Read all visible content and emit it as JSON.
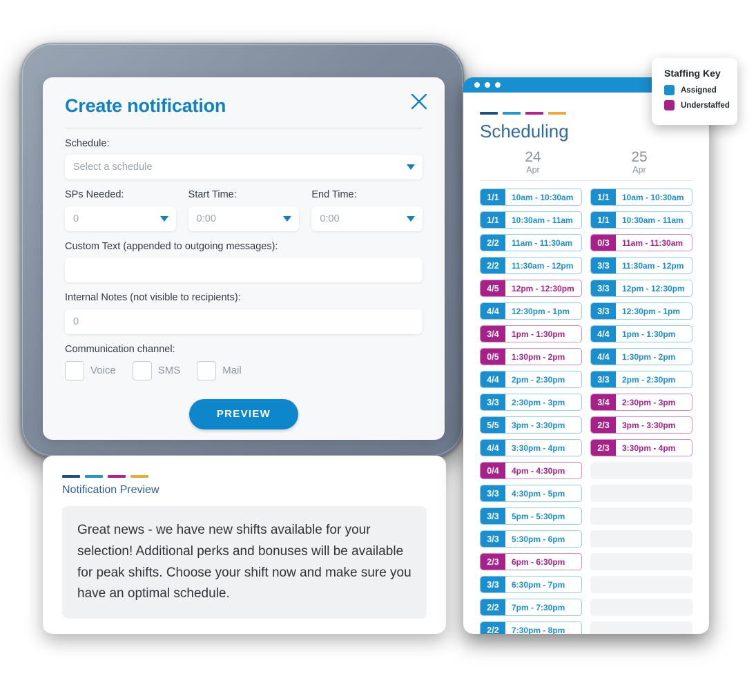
{
  "dialog": {
    "title": "Create notification",
    "close_icon": "close-x-icon",
    "schedule_label": "Schedule:",
    "schedule_placeholder": "Select a schedule",
    "sps_label": "SPs Needed:",
    "sps_value": "0",
    "start_label": "Start Time:",
    "start_value": "0:00",
    "end_label": "End Time:",
    "end_value": "0:00",
    "custom_text_label": "Custom Text (appended to outgoing messages):",
    "custom_text_value": "",
    "internal_notes_label": "Internal Notes (not visible to recipients):",
    "internal_notes_value": "0",
    "channel_label": "Communication channel:",
    "channels": [
      {
        "label": "Voice",
        "checked": false
      },
      {
        "label": "SMS",
        "checked": false
      },
      {
        "label": "Mail",
        "checked": false
      }
    ],
    "preview_button": "PREVIEW"
  },
  "preview": {
    "heading": "Notification Preview",
    "message": "Great news - we have new shifts available for your selection! Additional perks and bonuses will be available for peak shifts. Choose your shift now and make sure you have an optimal schedule.",
    "stripe_colors": [
      "#1d4f82",
      "#2196d6",
      "#b5218f",
      "#efa83b"
    ]
  },
  "scheduling": {
    "window_dots": 3,
    "stripe_colors": [
      "#1d4f82",
      "#2196d6",
      "#b5218f",
      "#efa83b"
    ],
    "title": "Scheduling",
    "days": [
      {
        "num": "24",
        "month": "Apr"
      },
      {
        "num": "25",
        "month": "Apr"
      }
    ],
    "columns": [
      {
        "day": "24 Apr",
        "shifts": [
          {
            "count": "1/1",
            "time": "10am - 10:30am",
            "status": "assigned"
          },
          {
            "count": "1/1",
            "time": "10:30am - 11am",
            "status": "assigned"
          },
          {
            "count": "2/2",
            "time": "11am - 11:30am",
            "status": "assigned"
          },
          {
            "count": "2/2",
            "time": "11:30am - 12pm",
            "status": "assigned"
          },
          {
            "count": "4/5",
            "time": "12pm - 12:30pm",
            "status": "understaffed"
          },
          {
            "count": "4/4",
            "time": "12:30pm - 1pm",
            "status": "assigned"
          },
          {
            "count": "3/4",
            "time": "1pm - 1:30pm",
            "status": "understaffed"
          },
          {
            "count": "0/5",
            "time": "1:30pm - 2pm",
            "status": "understaffed"
          },
          {
            "count": "4/4",
            "time": "2pm - 2:30pm",
            "status": "assigned"
          },
          {
            "count": "3/3",
            "time": "2:30pm - 3pm",
            "status": "assigned"
          },
          {
            "count": "5/5",
            "time": "3pm - 3:30pm",
            "status": "assigned"
          },
          {
            "count": "4/4",
            "time": "3:30pm - 4pm",
            "status": "assigned"
          },
          {
            "count": "0/4",
            "time": "4pm - 4:30pm",
            "status": "understaffed"
          },
          {
            "count": "3/3",
            "time": "4:30pm - 5pm",
            "status": "assigned"
          },
          {
            "count": "3/3",
            "time": "5pm - 5:30pm",
            "status": "assigned"
          },
          {
            "count": "3/3",
            "time": "5:30pm - 6pm",
            "status": "assigned"
          },
          {
            "count": "2/3",
            "time": "6pm - 6:30pm",
            "status": "understaffed"
          },
          {
            "count": "3/3",
            "time": "6:30pm - 7pm",
            "status": "assigned"
          },
          {
            "count": "2/2",
            "time": "7pm - 7:30pm",
            "status": "assigned"
          },
          {
            "count": "2/2",
            "time": "7:30pm - 8pm",
            "status": "assigned"
          }
        ]
      },
      {
        "day": "25 Apr",
        "shifts": [
          {
            "count": "1/1",
            "time": "10am - 10:30am",
            "status": "assigned"
          },
          {
            "count": "1/1",
            "time": "10:30am - 11am",
            "status": "assigned"
          },
          {
            "count": "0/3",
            "time": "11am - 11:30am",
            "status": "understaffed"
          },
          {
            "count": "3/3",
            "time": "11:30am - 12pm",
            "status": "assigned"
          },
          {
            "count": "3/3",
            "time": "12pm - 12:30pm",
            "status": "assigned"
          },
          {
            "count": "3/3",
            "time": "12:30pm - 1pm",
            "status": "assigned"
          },
          {
            "count": "4/4",
            "time": "1pm - 1:30pm",
            "status": "assigned"
          },
          {
            "count": "4/4",
            "time": "1:30pm - 2pm",
            "status": "assigned"
          },
          {
            "count": "3/3",
            "time": "2pm - 2:30pm",
            "status": "assigned"
          },
          {
            "count": "3/4",
            "time": "2:30pm - 3pm",
            "status": "understaffed"
          },
          {
            "count": "2/3",
            "time": "3pm - 3:30pm",
            "status": "understaffed"
          },
          {
            "count": "2/3",
            "time": "3:30pm - 4pm",
            "status": "understaffed"
          },
          {
            "count": "",
            "time": "",
            "status": "empty"
          },
          {
            "count": "",
            "time": "",
            "status": "empty"
          },
          {
            "count": "",
            "time": "",
            "status": "empty"
          },
          {
            "count": "",
            "time": "",
            "status": "empty"
          },
          {
            "count": "",
            "time": "",
            "status": "empty"
          },
          {
            "count": "",
            "time": "",
            "status": "empty"
          },
          {
            "count": "",
            "time": "",
            "status": "empty"
          },
          {
            "count": "",
            "time": "",
            "status": "empty"
          }
        ]
      }
    ]
  },
  "staffing_key": {
    "title": "Staffing Key",
    "items": [
      {
        "label": "Assigned",
        "color": "#1a8fd0"
      },
      {
        "label": "Understaffed",
        "color": "#a8208a"
      }
    ]
  }
}
